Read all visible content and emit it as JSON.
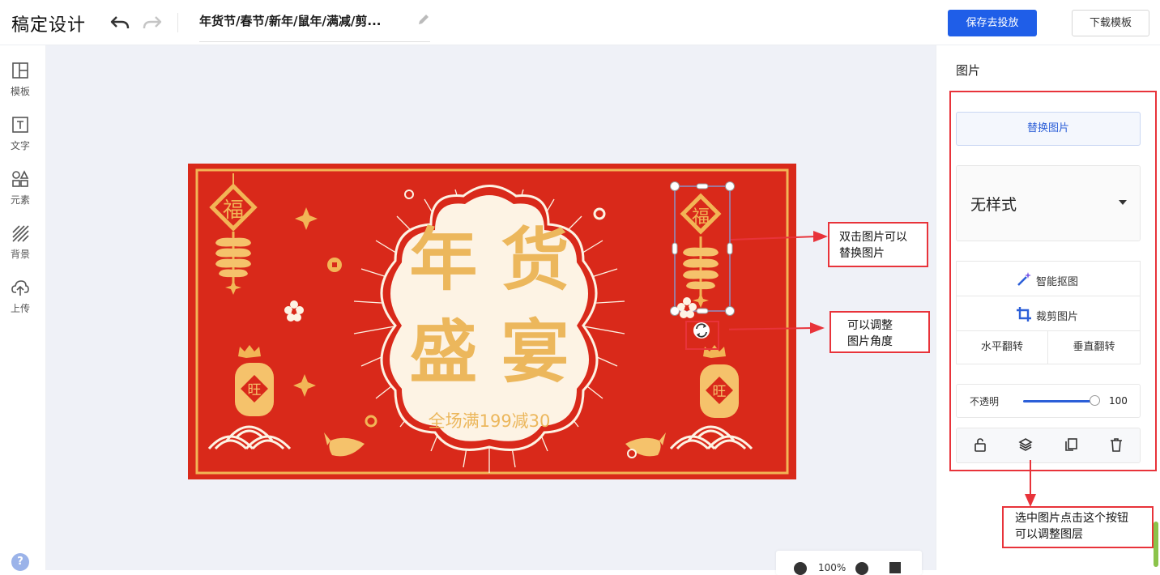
{
  "app": {
    "logo": "稿定设计",
    "doc_title": "年货节/春节/新年/鼠年/满减/剪...",
    "save_button": "保存去投放",
    "download_button": "下载模板"
  },
  "sidebar": {
    "items": [
      {
        "label": "模板",
        "icon": "template-icon"
      },
      {
        "label": "文字",
        "icon": "text-icon"
      },
      {
        "label": "元素",
        "icon": "elements-icon"
      },
      {
        "label": "背景",
        "icon": "background-icon"
      },
      {
        "label": "上传",
        "icon": "upload-icon"
      }
    ],
    "help": "?"
  },
  "canvas": {
    "banner": {
      "main_line1": "年 货",
      "main_line2": "盛 宴",
      "promo": "全场满199减30",
      "fu": "福",
      "wang": "旺",
      "colors": {
        "background": "#d9291a",
        "gold": "#f2b556",
        "cream": "#fdf3e4"
      }
    },
    "zoom": {
      "value": "100%"
    }
  },
  "panel": {
    "title": "图片",
    "replace_button": "替换图片",
    "style_select": "无样式",
    "smart_cutout": "智能抠图",
    "crop": "裁剪图片",
    "flip_horizontal": "水平翻转",
    "flip_vertical": "垂直翻转",
    "opacity_label": "不透明",
    "opacity_value": "100",
    "actions": [
      "lock-icon",
      "layers-icon",
      "duplicate-icon",
      "delete-icon"
    ]
  },
  "annotations": {
    "double_click": [
      "双击图片可以",
      "替换图片"
    ],
    "rotate": [
      "可以调整",
      "图片角度"
    ],
    "layer": [
      "选中图片点击这个按钮",
      "可以调整图层"
    ]
  }
}
